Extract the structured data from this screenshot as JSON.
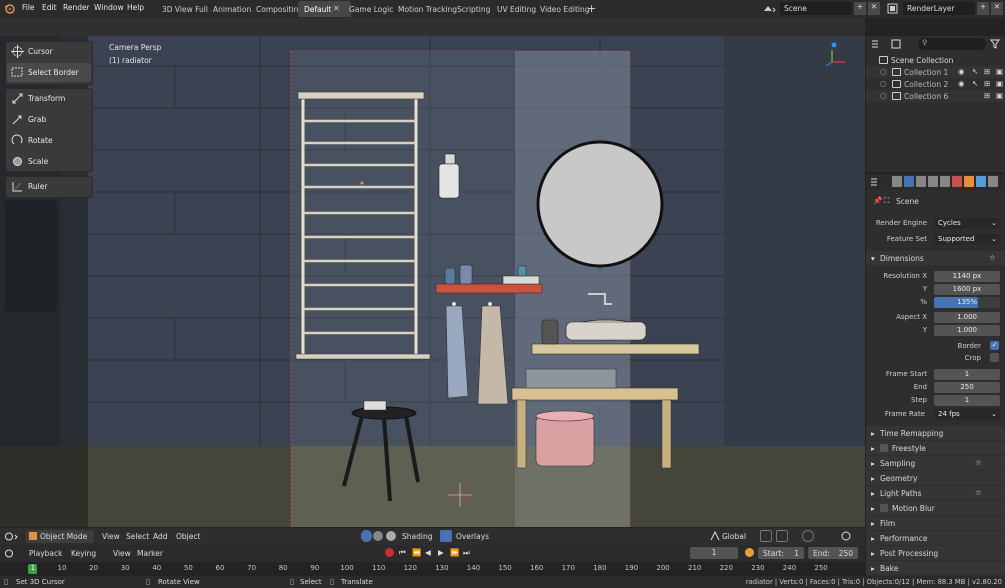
{
  "topbar": {
    "menu": [
      "File",
      "Edit",
      "Render",
      "Window",
      "Help"
    ],
    "tabs": [
      "3D View Full",
      "Animation",
      "Compositing",
      "Default",
      "Game Logic",
      "Motion Tracking",
      "Scripting",
      "UV Editing",
      "Video Editing"
    ],
    "active_tab": "Default",
    "scene": "Scene",
    "render_layer": "RenderLayer"
  },
  "viewport": {
    "camera_label": "Camera Persp",
    "object_label": "(1) radiator",
    "tools": {
      "cursor": "Cursor",
      "select_border": "Select Border",
      "transform": "Transform",
      "grab": "Grab",
      "rotate": "Rotate",
      "scale": "Scale",
      "ruler": "Ruler"
    },
    "footer": {
      "mode": "Object Mode",
      "view": "View",
      "select": "Select",
      "add": "Add",
      "object": "Object",
      "shading": "Shading",
      "overlays": "Overlays",
      "orientation": "Global"
    }
  },
  "timeline": {
    "playback": "Playback",
    "keying": "Keying",
    "view": "View",
    "marker": "Marker",
    "current_frame": "1",
    "start_label": "Start:",
    "start": "1",
    "end_label": "End:",
    "end": "250",
    "ticks": [
      "1",
      "10",
      "20",
      "30",
      "40",
      "50",
      "60",
      "70",
      "80",
      "90",
      "100",
      "110",
      "120",
      "130",
      "140",
      "150",
      "160",
      "170",
      "180",
      "190",
      "200",
      "210",
      "220",
      "230",
      "240",
      "250"
    ]
  },
  "statusbar": {
    "left": "Set 3D Cursor",
    "rotate": "Rotate View",
    "select": "Select",
    "translate": "Translate",
    "info": "radiator | Verts:0 | Faces:0 | Tris:0 | Objects:0/12 | Mem: 88.3 MB | v2.80.20"
  },
  "outliner": {
    "items": [
      "Scene Collection",
      "Collection 1",
      "Collection 2",
      "Collection 6"
    ]
  },
  "properties": {
    "scene": "Scene",
    "render_engine_label": "Render Engine",
    "render_engine": "Cycles",
    "feature_set_label": "Feature Set",
    "feature_set": "Supported",
    "dimensions": "Dimensions",
    "resolution_x_label": "Resolution X",
    "resolution_x": "1140 px",
    "y_label": "Y",
    "resolution_y": "1600 px",
    "pct_label": "%",
    "pct": "135%",
    "aspect_x_label": "Aspect X",
    "aspect_x": "1.000",
    "aspect_y": "1.000",
    "border": "Border",
    "crop": "Crop",
    "frame_start_label": "Frame Start",
    "frame_start": "1",
    "end_label": "End",
    "frame_end": "250",
    "step_label": "Step",
    "frame_step": "1",
    "frame_rate_label": "Frame Rate",
    "frame_rate": "24 fps",
    "panels": [
      "Time Remapping",
      "Freestyle",
      "Sampling",
      "Geometry",
      "Light Paths",
      "Motion Blur",
      "Film",
      "Performance",
      "Post Processing",
      "Bake"
    ]
  },
  "colors": {
    "accent_blue": "#4772b3",
    "wall": "#3a4250",
    "floor": "#4a4838",
    "frame_green": "#3aa34a"
  }
}
